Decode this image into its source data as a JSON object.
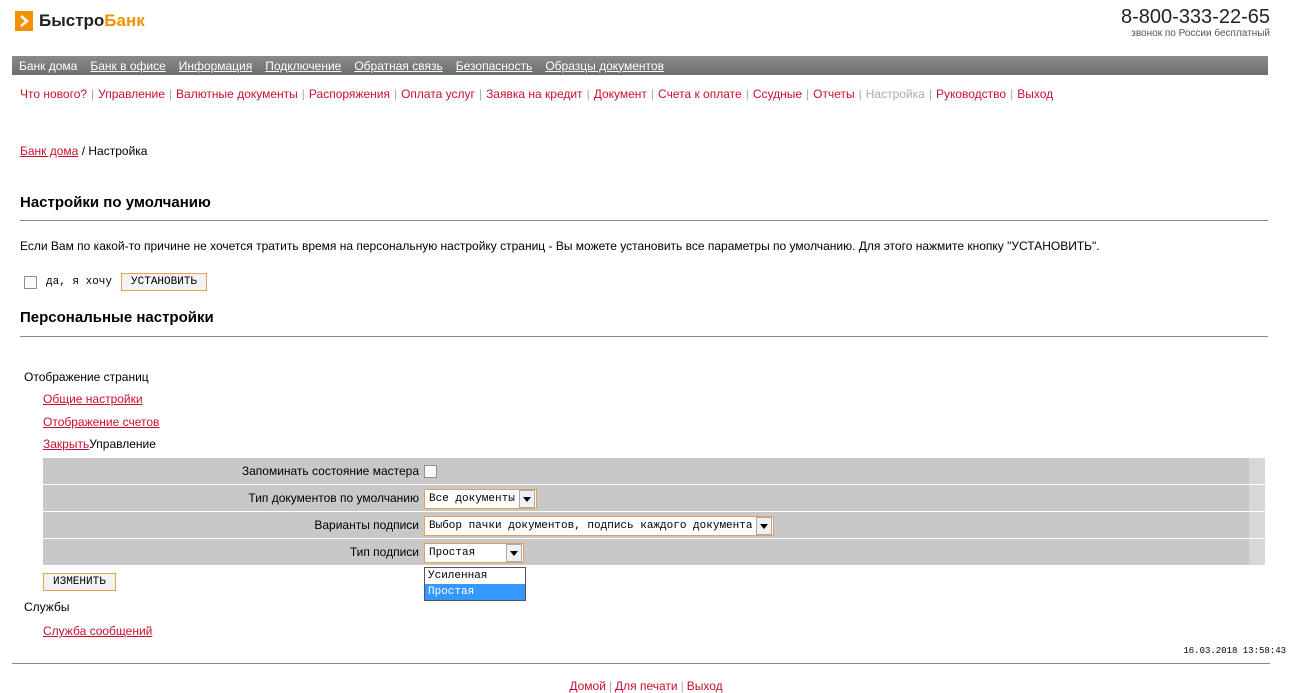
{
  "brand": {
    "name_part1": "Быстро",
    "name_part2": "Банк",
    "accent_color": "#f39200"
  },
  "contact": {
    "phone": "8-800-333-22-65",
    "phone_note": "звонок по России бесплатный"
  },
  "top_nav": {
    "items": [
      {
        "label": "Банк дома"
      },
      {
        "label": "Банк в офисе"
      },
      {
        "label": "Информация"
      },
      {
        "label": "Подключение"
      },
      {
        "label": "Обратная связь"
      },
      {
        "label": "Безопасность"
      },
      {
        "label": "Образцы документов"
      }
    ]
  },
  "sub_nav": {
    "items": [
      {
        "label": "Что нового?"
      },
      {
        "label": "Управление"
      },
      {
        "label": "Валютные документы"
      },
      {
        "label": "Распоряжения"
      },
      {
        "label": "Оплата услуг"
      },
      {
        "label": "Заявка на кредит"
      },
      {
        "label": "Документ"
      },
      {
        "label": "Счета к оплате"
      },
      {
        "label": "Ссудные"
      },
      {
        "label": "Отчеты"
      },
      {
        "label": "Настройка"
      },
      {
        "label": "Руководство"
      },
      {
        "label": "Выход"
      }
    ]
  },
  "breadcrumb": {
    "home": "Банк дома",
    "separator": "/",
    "current": "Настройка"
  },
  "defaults_section": {
    "title": "Настройки по умолчанию",
    "description": "Если Вам по какой-то причине не хочется тратить время на персональную настройку страниц - Вы можете установить все параметры по умолчанию. Для этого нажмите кнопку \"УСТАНОВИТЬ\".",
    "checkbox_label": "да, я хочу",
    "button": "УСТАНОВИТЬ"
  },
  "personal_section": {
    "title": "Персональные настройки",
    "group_label": "Отображение страниц",
    "links": {
      "general": "Общие настройки",
      "accounts": "Отображение счетов",
      "close": "Закрыть"
    },
    "management_label": "Управление",
    "rows": {
      "wizard": {
        "label": "Запоминать состояние мастера"
      },
      "doc_type": {
        "label": "Тип документов по умолчанию",
        "value": "Все документы"
      },
      "sign_variants": {
        "label": "Варианты подписи",
        "value": "Выбор пачки документов, подпись каждого документа"
      },
      "sign_type": {
        "label": "Тип подписи",
        "value": "Простая",
        "options": [
          "Усиленная",
          "Простая"
        ]
      }
    },
    "change_button": "ИЗМЕНИТЬ",
    "services_label": "Службы",
    "services_link": "Служба сообщений"
  },
  "timestamp": "16.03.2018 13:58:43",
  "footer": {
    "home": "Домой",
    "print": "Для печати",
    "exit": "Выход"
  }
}
